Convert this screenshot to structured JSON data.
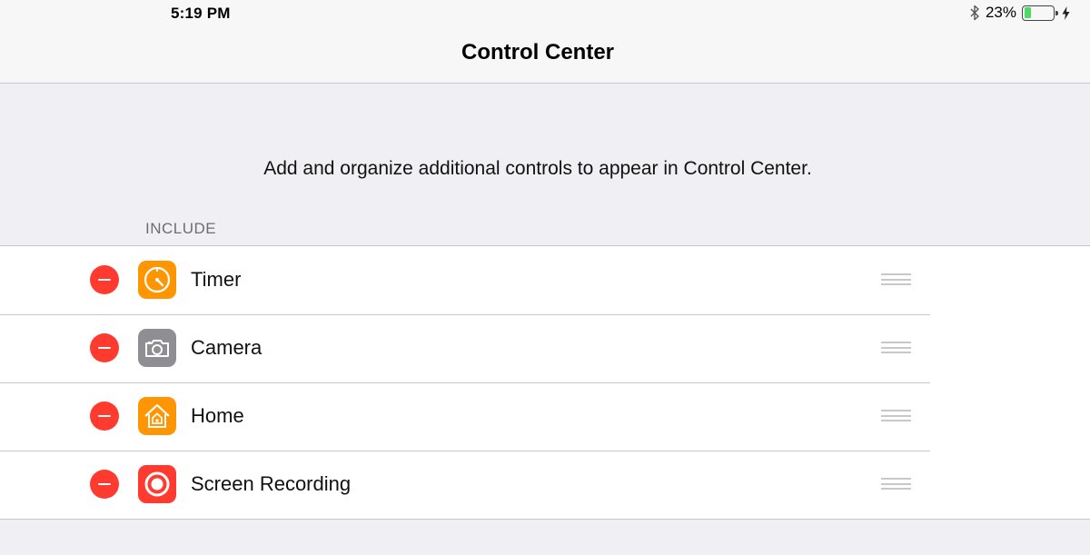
{
  "status_bar": {
    "time": "5:19 PM",
    "battery_percent": "23%",
    "battery_level": 0.23,
    "icons": [
      "bluetooth-icon",
      "battery-icon",
      "charging-bolt-icon"
    ]
  },
  "nav": {
    "title": "Control Center"
  },
  "description": "Add and organize additional controls to appear in Control Center.",
  "section": {
    "header": "INCLUDE",
    "items": [
      {
        "label": "Timer",
        "icon": "timer-icon",
        "icon_color": "#ff9500"
      },
      {
        "label": "Camera",
        "icon": "camera-icon",
        "icon_color": "#8e8e93"
      },
      {
        "label": "Home",
        "icon": "home-icon",
        "icon_color": "#ff9500"
      },
      {
        "label": "Screen Recording",
        "icon": "screen-recording-icon",
        "icon_color": "#ff3b30"
      }
    ]
  },
  "colors": {
    "remove": "#ff3b30",
    "background": "#efeff4",
    "battery_fill": "#4cd964"
  }
}
